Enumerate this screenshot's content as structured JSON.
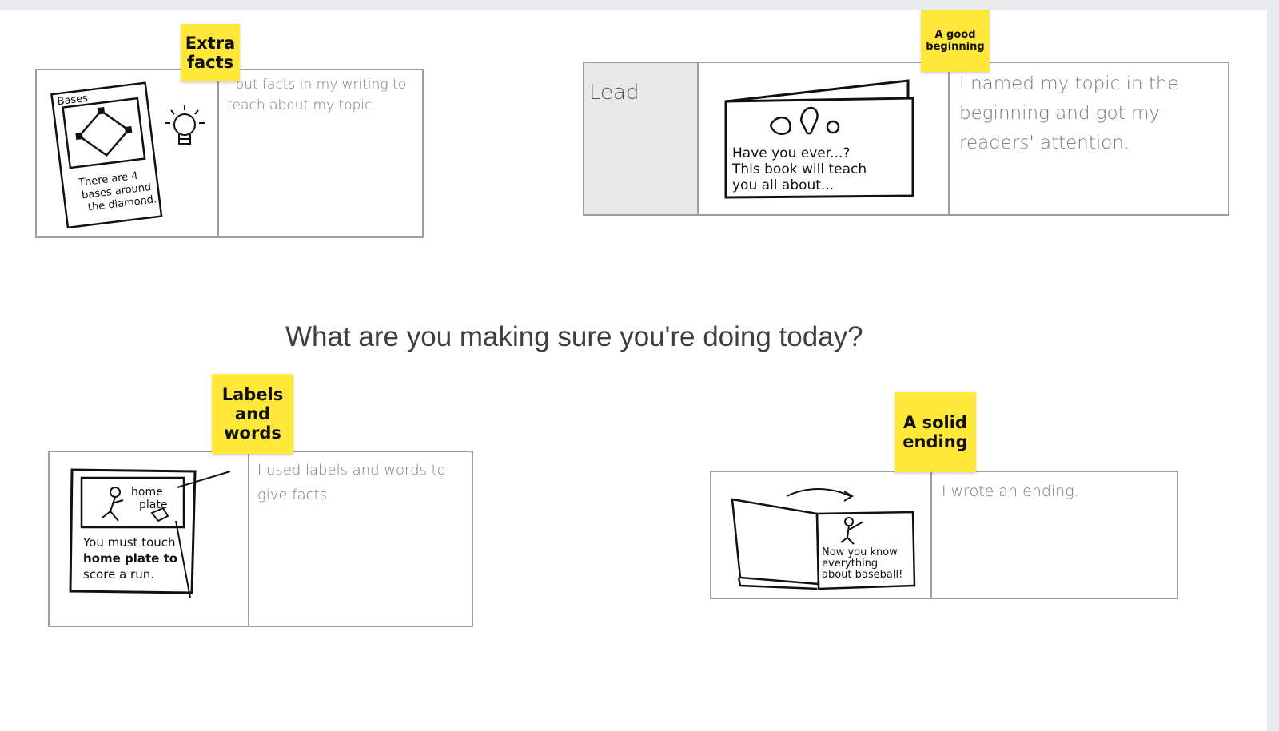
{
  "prompt": "What are you making sure  you're doing today?",
  "colors": {
    "sticky": "#ffe83a",
    "card_border": "#9e9e9e",
    "lead_cell": "#e8e8e8",
    "prompt_text": "#3c4043"
  },
  "cards": {
    "extra_facts": {
      "sticky": [
        "Extra",
        "facts"
      ],
      "description": "I put facts in my writing to teach about my topic.",
      "illustration": {
        "heading": "Bases",
        "caption": [
          "There are 4",
          "bases around",
          "the diamond."
        ]
      }
    },
    "good_beginning": {
      "sticky": [
        "A good",
        "beginning"
      ],
      "label": "Lead",
      "description": "I named my topic in the beginning and got my readers' attention.",
      "illustration": {
        "lines": [
          "Have you ever...?",
          "This book will teach",
          "you all about..."
        ]
      }
    },
    "labels_words": {
      "sticky": [
        "Labels",
        "and",
        "words"
      ],
      "description": "I used labels and words to give facts.",
      "illustration": {
        "label": [
          "home",
          "plate"
        ],
        "caption": [
          "You must touch",
          "home plate to",
          "score  a  run."
        ]
      }
    },
    "solid_ending": {
      "sticky": [
        "A solid",
        "ending"
      ],
      "description": "I wrote an ending.",
      "illustration": {
        "lines": [
          "Now you know",
          "everything",
          "about baseball!"
        ]
      }
    }
  }
}
